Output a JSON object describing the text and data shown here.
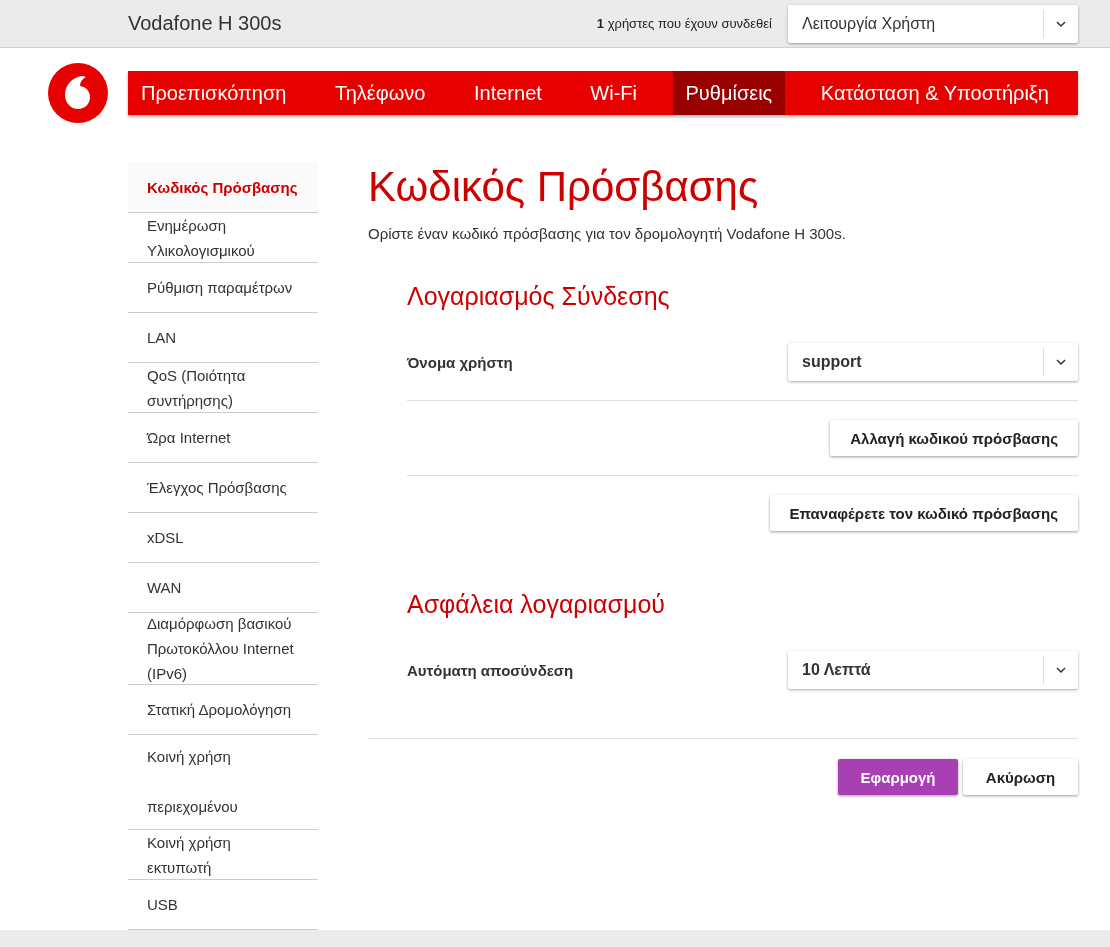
{
  "header": {
    "title": "Vodafone H 300s",
    "users_text": "**1** χρήστες που έχουν συνδεθεί",
    "mode_select": {
      "value": "Λειτουργία Χρήστη"
    }
  },
  "nav": {
    "tabs": [
      {
        "label": "Προεπισκόπηση",
        "selected": false
      },
      {
        "label": "Τηλέφωνο",
        "selected": false
      },
      {
        "label": "Internet",
        "selected": false
      },
      {
        "label": "Wi-Fi",
        "selected": false
      },
      {
        "label": "Ρυθμίσεις",
        "selected": true
      },
      {
        "label": "Κατάσταση & Υποστήριξη",
        "selected": false
      }
    ]
  },
  "sidebar": {
    "items": [
      {
        "label": "Κωδικός Πρόσβασης",
        "selected": true
      },
      {
        "label": "Ενημέρωση Υλικολογισμικού",
        "selected": false
      },
      {
        "label": "Ρύθμιση παραμέτρων",
        "selected": false
      },
      {
        "label": "LAN",
        "selected": false
      },
      {
        "label": "QoS (Ποιότητα συντήρησης)",
        "selected": false
      },
      {
        "label": "Ώρα Internet",
        "selected": false
      },
      {
        "label": "Έλεγχος Πρόσβασης",
        "selected": false
      },
      {
        "label": "xDSL",
        "selected": false
      },
      {
        "label": "WAN",
        "selected": false
      },
      {
        "label": "Διαμόρφωση βασικού Πρωτοκόλλου Internet (IPv6)",
        "selected": false
      },
      {
        "label": "Στατική Δρομολόγηση",
        "selected": false
      },
      {
        "label": "Κοινή χρήση περιεχομένου",
        "selected": false
      },
      {
        "label": "Κοινή χρήση εκτυπωτή",
        "selected": false
      },
      {
        "label": "USB",
        "selected": false
      }
    ]
  },
  "page": {
    "title": "Κωδικός Πρόσβασης",
    "description": "Ορίστε έναν κωδικό πρόσβασης για τον δρομολογητή Vodafone H 300s.",
    "sections": [
      {
        "title": "Λογαριασμός Σύνδεσης",
        "rows": [
          {
            "kind": "select",
            "label": "Όνομα χρήστη",
            "value": "support"
          },
          {
            "kind": "button",
            "label": "Αλλαγή κωδικού πρόσβασης"
          },
          {
            "kind": "button",
            "label": "Επαναφέρετε τον κωδικό πρόσβασης"
          }
        ]
      },
      {
        "title": "Ασφάλεια λογαριασμού",
        "rows": [
          {
            "kind": "select",
            "label": "Αυτόματη αποσύνδεση",
            "value": "10 Λεπτά"
          }
        ]
      }
    ],
    "actions": [
      {
        "kind": "primary",
        "label": "Εφαρμογή"
      },
      {
        "kind": "secondary",
        "label": "Ακύρωση"
      }
    ]
  }
}
